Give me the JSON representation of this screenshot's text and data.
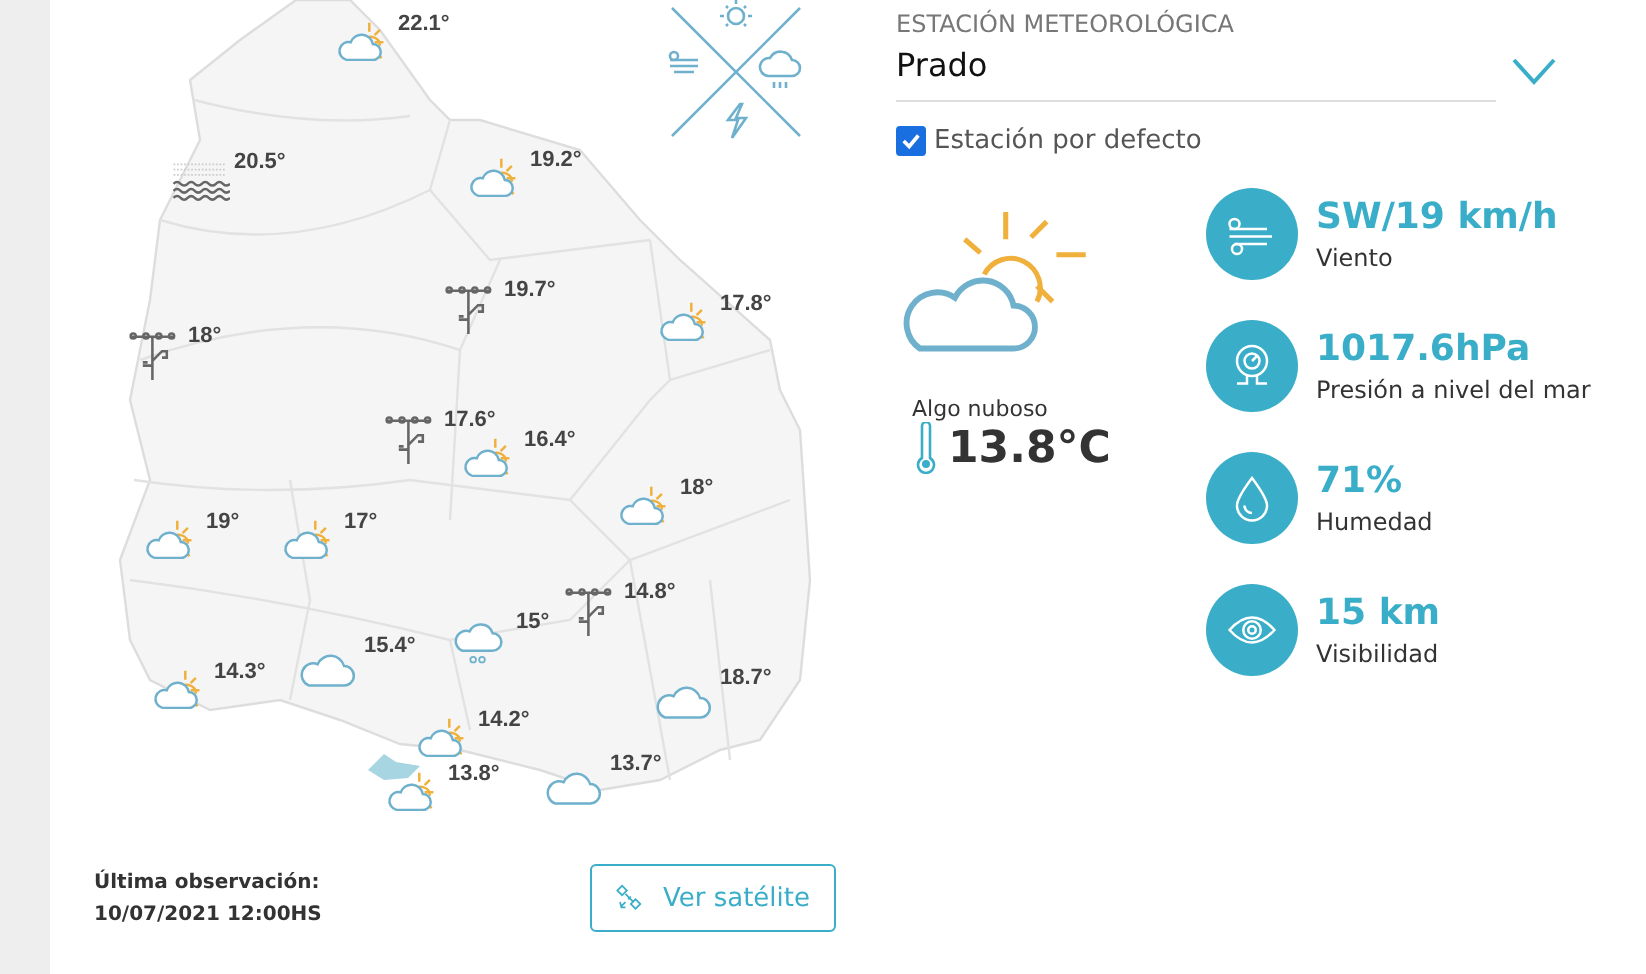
{
  "map": {
    "markers": [
      {
        "kind": "partly_cloudy",
        "temperature": "22.1°",
        "selected": false
      },
      {
        "kind": "fog",
        "temperature": "20.5°",
        "selected": false
      },
      {
        "kind": "partly_cloudy",
        "temperature": "19.2°",
        "selected": false
      },
      {
        "kind": "station",
        "temperature": "19.7°",
        "selected": false
      },
      {
        "kind": "station",
        "temperature": "18°",
        "selected": false
      },
      {
        "kind": "partly_cloudy",
        "temperature": "17.8°",
        "selected": false
      },
      {
        "kind": "station",
        "temperature": "17.6°",
        "selected": false
      },
      {
        "kind": "partly_cloudy",
        "temperature": "16.4°",
        "selected": false
      },
      {
        "kind": "partly_cloudy",
        "temperature": "18°",
        "selected": false
      },
      {
        "kind": "partly_cloudy",
        "temperature": "19°",
        "selected": false
      },
      {
        "kind": "partly_cloudy",
        "temperature": "17°",
        "selected": false
      },
      {
        "kind": "station",
        "temperature": "14.8°",
        "selected": false
      },
      {
        "kind": "drizzle",
        "temperature": "15°",
        "selected": false
      },
      {
        "kind": "cloudy",
        "temperature": "15.4°",
        "selected": false
      },
      {
        "kind": "partly_cloudy",
        "temperature": "14.3°",
        "selected": false
      },
      {
        "kind": "cloudy",
        "temperature": "18.7°",
        "selected": false
      },
      {
        "kind": "partly_cloudy",
        "temperature": "14.2°",
        "selected": false
      },
      {
        "kind": "partly_cloudy",
        "temperature": "13.8°",
        "selected": true
      },
      {
        "kind": "cloudy",
        "temperature": "13.7°",
        "selected": false
      }
    ]
  },
  "footer": {
    "last_observation_label": "Última observación:",
    "last_observation_time": "10/07/2021 12:00HS",
    "satellite_button": "Ver satélite"
  },
  "station_selector": {
    "label": "ESTACIÓN METEOROLÓGICA",
    "value": "Prado"
  },
  "default_station": {
    "label": "Estación por defecto",
    "checked": true
  },
  "current": {
    "condition": "Algo nuboso",
    "temperature": "13.8°C"
  },
  "stats": [
    {
      "kind": "wind",
      "value": "SW/19 km/h",
      "label": "Viento"
    },
    {
      "kind": "pressure",
      "value": "1017.6hPa",
      "label": "Presión a nivel del mar"
    },
    {
      "kind": "humidity",
      "value": "71%",
      "label": "Humedad"
    },
    {
      "kind": "visibility",
      "value": "15 km",
      "label": "Visibilidad"
    }
  ]
}
